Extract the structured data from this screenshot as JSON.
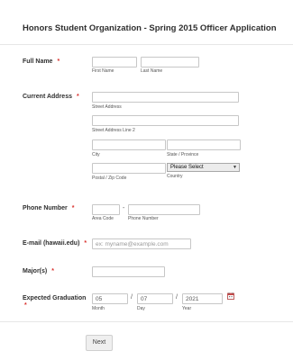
{
  "form": {
    "title": "Honors Student Organization - Spring 2015 Officer Application",
    "required_mark": "*"
  },
  "full_name": {
    "label": "Full Name",
    "first_value": "",
    "last_value": "",
    "first_sublabel": "First Name",
    "last_sublabel": "Last Name"
  },
  "address": {
    "label": "Current Address",
    "street_value": "",
    "street2_value": "",
    "city_value": "",
    "state_value": "",
    "zip_value": "",
    "street_sublabel": "Street Address",
    "street2_sublabel": "Street Address Line 2",
    "city_sublabel": "City",
    "state_sublabel": "State / Province",
    "zip_sublabel": "Postal / Zip Code",
    "country_sublabel": "Country",
    "country_selected": "Please Select",
    "dropdown_arrow": "▼"
  },
  "phone": {
    "label": "Phone Number",
    "area_value": "",
    "number_value": "",
    "separator": "-",
    "area_sublabel": "Area Code",
    "number_sublabel": "Phone Number"
  },
  "email": {
    "label": "E-mail (hawaii.edu)",
    "placeholder": "ex: myname@example.com"
  },
  "majors": {
    "label": "Major(s)",
    "value": ""
  },
  "graduation": {
    "label": "Expected Graduation",
    "month": "05",
    "day": "07",
    "year": "2021",
    "separator": "/",
    "month_sublabel": "Month",
    "day_sublabel": "Day",
    "year_sublabel": "Year",
    "calendar_icon": "calendar-icon"
  },
  "actions": {
    "next_label": "Next"
  },
  "colors": {
    "required": "#d9302c",
    "border": "#c7c7c7"
  }
}
